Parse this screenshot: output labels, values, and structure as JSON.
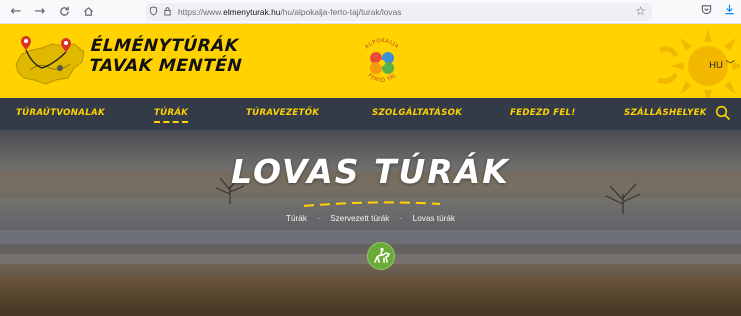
{
  "browser": {
    "url_prefix": "https://www.",
    "url_domain": "elmenyturak.hu",
    "url_path": "/hu/alpokalja-ferto-taj/turak/lovas"
  },
  "header": {
    "brand_line1": "ÉLMÉNYTÚRÁK",
    "brand_line2": "TAVAK MENTÉN",
    "center_logo_text_top": "ALPOKALJA",
    "center_logo_text_bottom": "FERTŐ TÁJ",
    "language": "HU"
  },
  "nav": {
    "items": [
      {
        "label": "TÚRAÚTVONALAK"
      },
      {
        "label": "TÚRÁK"
      },
      {
        "label": "TÚRAVEZETŐK"
      },
      {
        "label": "SZOLGÁLTATÁSOK"
      },
      {
        "label": "FEDEZD FEL!"
      },
      {
        "label": "SZÁLLÁSHELYEK"
      }
    ],
    "active_index": 1
  },
  "hero": {
    "title": "LOVAS TÚRÁK",
    "breadcrumb": [
      "Túrák",
      "Szervezett túrák",
      "Lovas túrák"
    ],
    "badge_icon": "horse-rider-icon"
  },
  "colors": {
    "brand_yellow": "#ffd200",
    "nav_bg": "#333a48",
    "badge_green": "#6bab3a"
  }
}
